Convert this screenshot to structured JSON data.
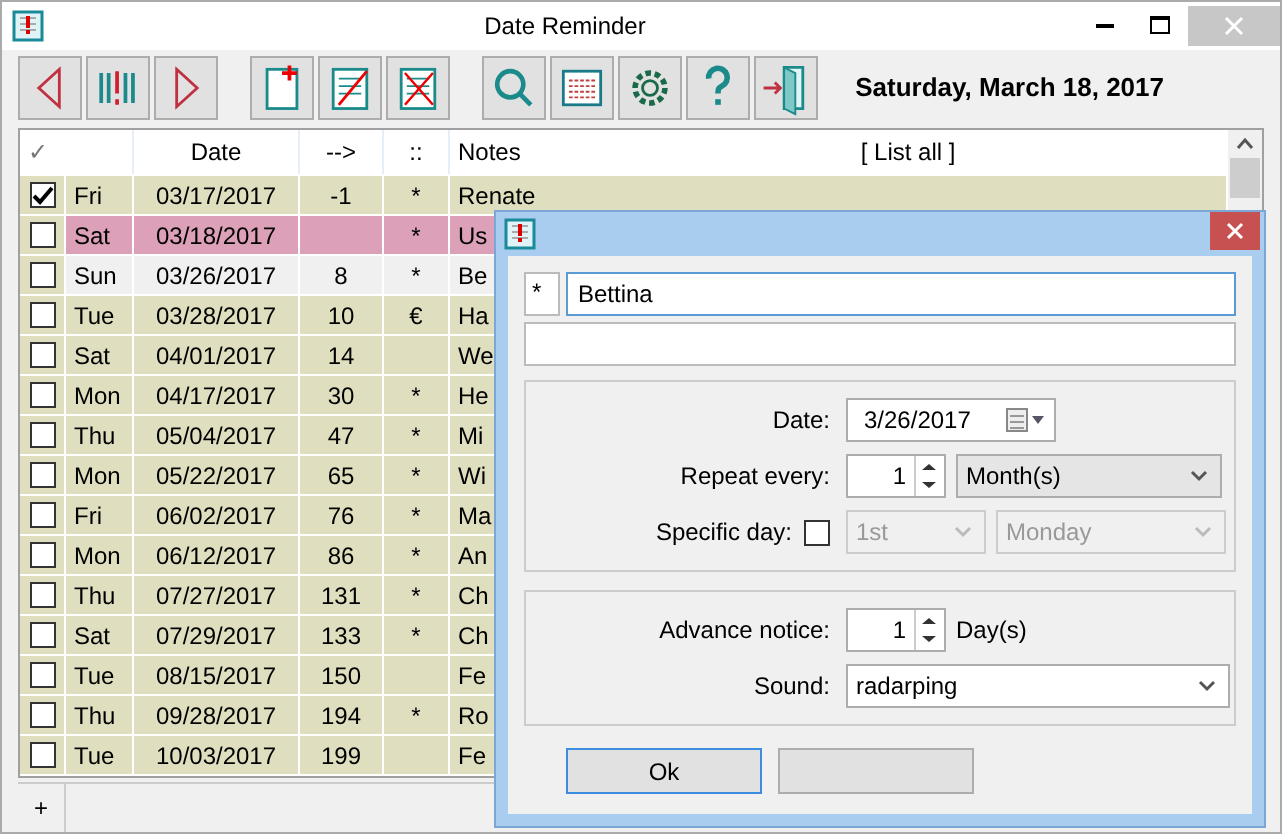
{
  "window": {
    "title": "Date Reminder"
  },
  "toolbar": {
    "buttons": [
      {
        "kind": "previous"
      },
      {
        "kind": "today"
      },
      {
        "kind": "next"
      },
      {
        "kind": "new"
      },
      {
        "kind": "edit"
      },
      {
        "kind": "delete"
      },
      {
        "kind": "search"
      },
      {
        "kind": "list"
      },
      {
        "kind": "settings"
      },
      {
        "kind": "help"
      },
      {
        "kind": "exit"
      }
    ],
    "current_date": "Saturday, March 18, 2017"
  },
  "list": {
    "columns": [
      "✓",
      "Date",
      "-->",
      "::",
      "Notes"
    ],
    "list_all": "[ List all ]",
    "rows": [
      {
        "checked": true,
        "day": "Fri",
        "date": "03/17/2017",
        "days_left": "-1",
        "mark": "*",
        "note": "Renate",
        "color": "#dfdfbf"
      },
      {
        "checked": false,
        "day": "Sat",
        "date": "03/18/2017",
        "mark": "*",
        "note": "Us",
        "color": "#dca0b8"
      },
      {
        "checked": false,
        "day": "Sun",
        "date": "03/26/2017",
        "days_left": "8",
        "mark": "*",
        "note": "Be",
        "color": "#f0f0f0"
      },
      {
        "checked": false,
        "day": "Tue",
        "date": "03/28/2017",
        "days_left": "10",
        "mark": "€",
        "note": "Ha",
        "color": "#dfdfbf"
      },
      {
        "checked": false,
        "day": "Sat",
        "date": "04/01/2017",
        "days_left": "14",
        "note": "We",
        "color": "#dfdfbf"
      },
      {
        "checked": false,
        "day": "Mon",
        "date": "04/17/2017",
        "days_left": "30",
        "mark": "*",
        "note": "He",
        "color": "#dfdfbf"
      },
      {
        "checked": false,
        "day": "Thu",
        "date": "05/04/2017",
        "days_left": "47",
        "mark": "*",
        "note": "Mi",
        "color": "#dfdfbf"
      },
      {
        "checked": false,
        "day": "Mon",
        "date": "05/22/2017",
        "days_left": "65",
        "mark": "*",
        "note": "Wi",
        "color": "#dfdfbf"
      },
      {
        "checked": false,
        "day": "Fri",
        "date": "06/02/2017",
        "days_left": "76",
        "mark": "*",
        "note": "Ma",
        "color": "#dfdfbf"
      },
      {
        "checked": false,
        "day": "Mon",
        "date": "06/12/2017",
        "days_left": "86",
        "mark": "*",
        "note": "An",
        "color": "#dfdfbf"
      },
      {
        "checked": false,
        "day": "Thu",
        "date": "07/27/2017",
        "days_left": "131",
        "mark": "*",
        "note": "Ch",
        "color": "#dfdfbf"
      },
      {
        "checked": false,
        "day": "Sat",
        "date": "07/29/2017",
        "days_left": "133",
        "mark": "*",
        "note": "Ch",
        "color": "#dfdfbf"
      },
      {
        "checked": false,
        "day": "Tue",
        "date": "08/15/2017",
        "days_left": "150",
        "note": "Fe",
        "color": "#dfdfbf"
      },
      {
        "checked": false,
        "day": "Thu",
        "date": "09/28/2017",
        "days_left": "194",
        "mark": "*",
        "note": "Ro",
        "color": "#dfdfbf"
      },
      {
        "checked": false,
        "day": "Tue",
        "date": "10/03/2017",
        "days_left": "199",
        "note": "Fe",
        "color": "#dfdfbf"
      }
    ]
  },
  "tabs": [
    {
      "label": "+"
    }
  ],
  "dialog": {
    "mark": "*",
    "name": "Bettina",
    "date_label": "Date:",
    "date": "3/26/2017",
    "repeat_label": "Repeat every:",
    "repeat_count": "1",
    "repeat_unit": "Month(s)",
    "specific_label": "Specific day:",
    "specific_checked": false,
    "specific_disabled": true,
    "specific_ordinal": "1st",
    "specific_weekday": "Monday",
    "advance_label": "Advance notice:",
    "advance_count": "1",
    "advance_unit": "Day(s)",
    "sound_label": "Sound:",
    "sound": "radarping",
    "buttons": [
      {
        "label": "Ok",
        "focused": true
      },
      {
        "focused": false
      }
    ]
  }
}
